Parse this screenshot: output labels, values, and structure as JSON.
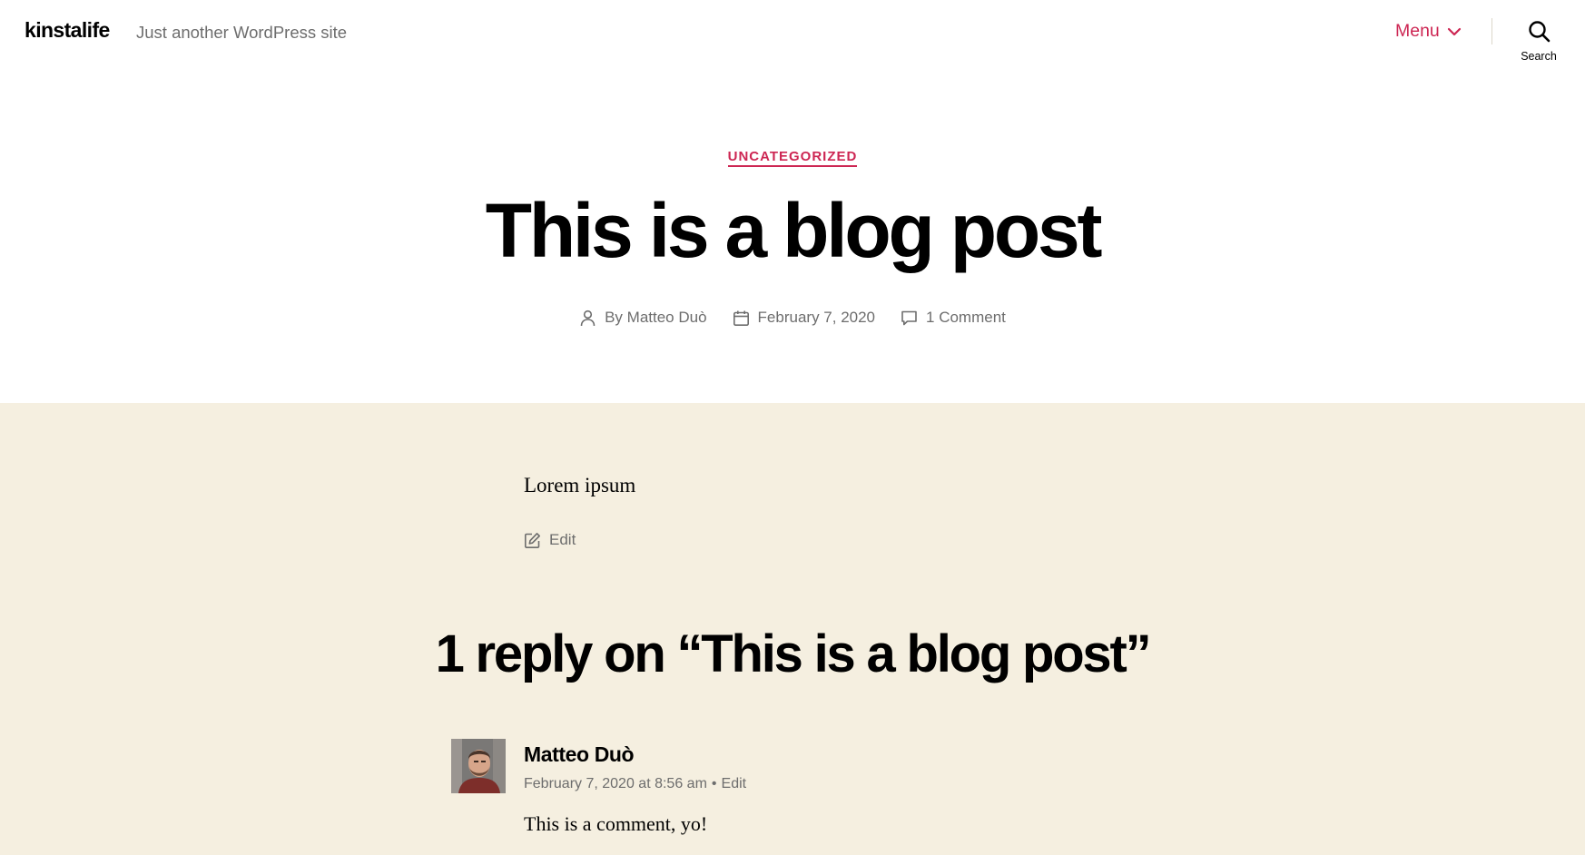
{
  "site": {
    "title": "kinstalife",
    "description": "Just another WordPress site"
  },
  "header": {
    "menu_label": "Menu",
    "search_label": "Search"
  },
  "post": {
    "category": "UNCATEGORIZED",
    "title": "This is a blog post",
    "meta": {
      "author": "By Matteo Duò",
      "date": "February 7, 2020",
      "comments": "1 Comment"
    },
    "body": "Lorem ipsum",
    "edit_label": "Edit"
  },
  "comments": {
    "title": "1 reply on “This is a blog post”",
    "items": [
      {
        "author": "Matteo Duò",
        "date": "February 7, 2020 at 8:56 am",
        "separator": "•",
        "edit_label": "Edit",
        "text": "This is a comment, yo!"
      }
    ]
  },
  "colors": {
    "accent": "#cd2653",
    "content_background": "#f5efe0",
    "meta_text": "#6d6d6d"
  },
  "icons": {
    "menu": "chevron-down-icon",
    "search": "search-icon",
    "author": "user-icon",
    "date": "calendar-icon",
    "comments": "comment-icon",
    "edit": "edit-icon"
  }
}
